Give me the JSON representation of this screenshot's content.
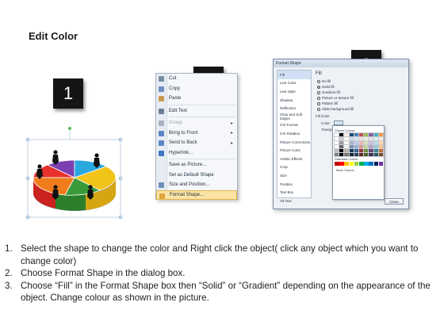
{
  "title": "Edit Color",
  "steps": [
    "1",
    "2",
    "3"
  ],
  "context_menu": {
    "items": [
      {
        "label": "Cut",
        "icon": "scissors-icon",
        "color": "#7a8fa8"
      },
      {
        "label": "Copy",
        "icon": "copy-icon",
        "color": "#6f8fc4"
      },
      {
        "label": "Paste",
        "icon": "paste-icon",
        "color": "#c69c52"
      },
      {
        "label": "Edit Text",
        "icon": "text-icon",
        "color": "#6d7f96"
      },
      {
        "label": "Group",
        "icon": "group-icon",
        "color": "#a9b3bf",
        "disabled": true,
        "submenu": true
      },
      {
        "label": "Bring to Front",
        "icon": "bring-front-icon",
        "color": "#5a88c7",
        "submenu": true
      },
      {
        "label": "Send to Back",
        "icon": "send-back-icon",
        "color": "#5a88c7",
        "submenu": true
      },
      {
        "label": "Hyperlink...",
        "icon": "hyperlink-icon",
        "color": "#3c78c4"
      },
      {
        "label": "Save as Picture...",
        "icon": "",
        "color": ""
      },
      {
        "label": "Set as Default Shape",
        "icon": "",
        "color": ""
      },
      {
        "label": "Size and Position...",
        "icon": "size-icon",
        "color": "#6c8fb8"
      },
      {
        "label": "Format Shape...",
        "icon": "format-shape-icon",
        "color": "#e0a43a",
        "highlight": true
      }
    ]
  },
  "dialog": {
    "title": "Format Shape",
    "categories": [
      "Fill",
      "Line Color",
      "Line Style",
      "Shadow",
      "Reflection",
      "Glow and Soft Edges",
      "3-D Format",
      "3-D Rotation",
      "Picture Corrections",
      "Picture Color",
      "Artistic Effects",
      "Crop",
      "Size",
      "Position",
      "Text Box",
      "Alt Text"
    ],
    "fill_heading": "Fill",
    "options": [
      "No fill",
      "Solid fill",
      "Gradient fill",
      "Picture or texture fill",
      "Pattern fill",
      "Slide background fill"
    ],
    "selected_option": 1,
    "fill_color_heading": "Fill Color",
    "color_label": "Color:",
    "transparency_label": "Transpa",
    "theme_colors_label": "Theme Colors",
    "standard_colors_label": "Standard Colors",
    "more_colors_label": "More Colors...",
    "close_label": "Close"
  },
  "instructions": [
    {
      "num": "1.",
      "text": "Select the shape to change the color and Right click the object( click any object which you want to change color)"
    },
    {
      "num": "2.",
      "text": "Choose Format Shape in the dialog box."
    },
    {
      "num": "3.",
      "text": "Choose “Fill” in the Format Shape box then “Solid” or “Gradient” depending on the appearance of the object. Change colour as shown in the picture."
    }
  ],
  "colors": {
    "puzzle_pieces": [
      "#e8312d",
      "#7b3fb0",
      "#2aa8e0",
      "#3a9a3a",
      "#f2c318",
      "#f07c1c"
    ],
    "theme_palette": [
      "#ffffff",
      "#000000",
      "#eeece1",
      "#1f497d",
      "#4f81bd",
      "#c0504d",
      "#9bbb59",
      "#8064a2",
      "#4bacc6",
      "#f79646"
    ],
    "standard_palette": [
      "#c00000",
      "#ff0000",
      "#ffc000",
      "#ffff00",
      "#92d050",
      "#00b050",
      "#00b0f0",
      "#0070c0",
      "#002060",
      "#7030a0"
    ]
  }
}
